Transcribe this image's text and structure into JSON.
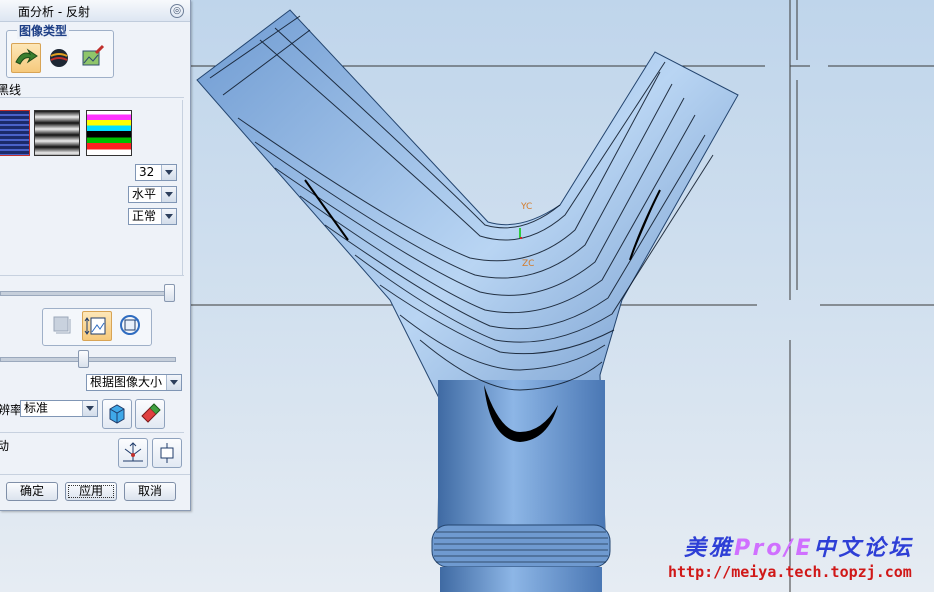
{
  "panel": {
    "title": "面分析 - 反射",
    "image_type_group": "图像类型",
    "image_type_buttons": [
      "line-image-icon",
      "fake-image-icon",
      "user-image-icon"
    ],
    "line_label_partial": "黑线",
    "swatches": [
      "black-lines-swatch",
      "gray-lines-swatch",
      "color-lines-swatch"
    ],
    "line_count": "32",
    "direction": "水平",
    "type_value": "正常",
    "image_scale": "根据图像大小",
    "resolution_label_partial": "辨率",
    "resolution": "标准",
    "move_label_partial": "动",
    "ok": "确定",
    "apply": "应用",
    "cancel": "取消"
  },
  "viewport": {
    "axis_labels": {
      "yc": "YC",
      "zc": "ZC"
    },
    "colors": {
      "model_blue": "#7fa9d8",
      "background": "#c9dbee"
    }
  },
  "watermark": {
    "text_a": "美雅",
    "text_pc": "Pro/E",
    "text_b": "中文论坛",
    "url": "http://meiya.tech.topzj.com"
  }
}
